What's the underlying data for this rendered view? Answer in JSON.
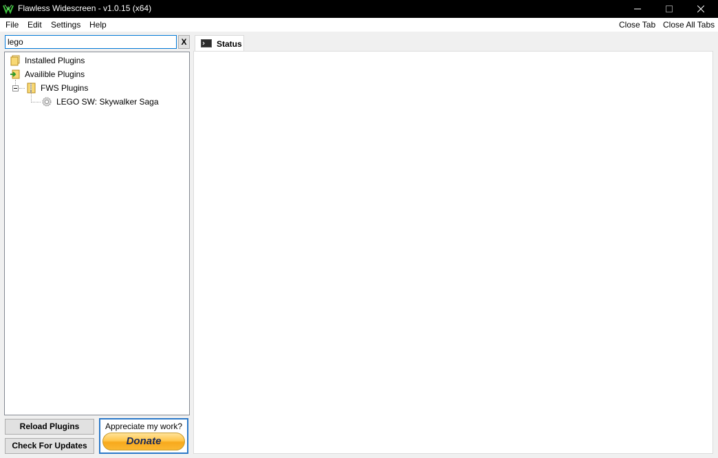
{
  "window": {
    "title": "Flawless Widescreen - v1.0.15 (x64)",
    "min_icon": "minimize-icon",
    "max_icon": "maximize-icon",
    "close_icon": "close-icon"
  },
  "menu": {
    "items": [
      {
        "label": "File"
      },
      {
        "label": "Edit"
      },
      {
        "label": "Settings"
      },
      {
        "label": "Help"
      }
    ],
    "close_tab": "Close Tab",
    "close_all_tabs": "Close All Tabs"
  },
  "search": {
    "value": "lego",
    "clear_label": "X"
  },
  "tree": {
    "installed": {
      "label": "Installed Plugins",
      "icon": "folder-icon"
    },
    "available": {
      "label": "Availible Plugins",
      "icon": "add-folder-icon"
    },
    "fws": {
      "label": "FWS Plugins",
      "icon": "zip-folder-icon",
      "expanded": true
    },
    "plugin": {
      "label": "LEGO SW: Skywalker Saga",
      "icon": "gear-icon"
    }
  },
  "buttons": {
    "reload": "Reload Plugins",
    "updates": "Check For Updates"
  },
  "donate": {
    "prompt": "Appreciate my work?",
    "label": "Donate",
    "accent": "#2a78c8"
  },
  "tabs": [
    {
      "label": "Status",
      "icon": "console-icon",
      "active": true
    }
  ]
}
